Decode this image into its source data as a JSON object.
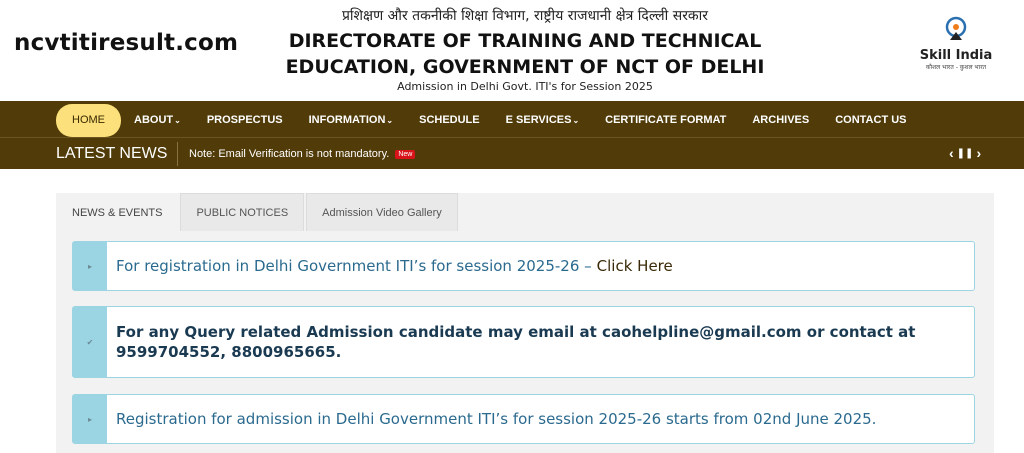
{
  "header": {
    "brand": "ncvtitiresult.com",
    "hindi_title": "प्रशिक्षण और तकनीकी शिक्षा विभाग, राष्ट्रीय राजधानी क्षेत्र दिल्ली सरकार",
    "title_line1": "DIRECTORATE OF TRAINING AND TECHNICAL",
    "title_line2": "EDUCATION, GOVERNMENT OF NCT OF DELHI",
    "subtitle": "Admission in Delhi Govt. ITI's for Session 2025",
    "skill_logo": {
      "name": "Skill India",
      "tagline": "कौशल भारत - कुशल भारत",
      "icon": "skill-india-logo-icon"
    }
  },
  "nav": {
    "items": [
      {
        "label": "HOME",
        "active": true,
        "dropdown": false
      },
      {
        "label": "ABOUT",
        "active": false,
        "dropdown": true
      },
      {
        "label": "PROSPECTUS",
        "active": false,
        "dropdown": false
      },
      {
        "label": "INFORMATION",
        "active": false,
        "dropdown": true
      },
      {
        "label": "SCHEDULE",
        "active": false,
        "dropdown": false
      },
      {
        "label": "E SERVICES",
        "active": false,
        "dropdown": true
      },
      {
        "label": "CERTIFICATE FORMAT",
        "active": false,
        "dropdown": false
      },
      {
        "label": "ARCHIVES",
        "active": false,
        "dropdown": false
      },
      {
        "label": "CONTACT US",
        "active": false,
        "dropdown": false
      }
    ],
    "bg_color": "#513c09",
    "active_color": "#fbe07c"
  },
  "news": {
    "label": "LATEST NEWS",
    "text": "Note: Email Verification is not mandatory.",
    "badge": "New",
    "controls": {
      "prev": "‹",
      "pause": "❚❚",
      "next": "›"
    }
  },
  "tabs": [
    {
      "label": "NEWS & EVENTS",
      "active": true
    },
    {
      "label": "PUBLIC NOTICES",
      "active": false
    },
    {
      "label": "Admission Video Gallery",
      "active": false
    }
  ],
  "notices": [
    {
      "text": "For registration in Delhi Government ITI’s for session 2025-26 –",
      "link": "Click Here",
      "icon": "arrow-icon"
    },
    {
      "text": "For any Query related Admission candidate may email at caohelpline@gmail.com or contact at 9599704552, 8800965665.",
      "icon": "check-icon"
    },
    {
      "text": "Registration for admission in Delhi Government ITI’s for session 2025-26 starts from 02nd June 2025.",
      "icon": "arrow-icon"
    }
  ]
}
